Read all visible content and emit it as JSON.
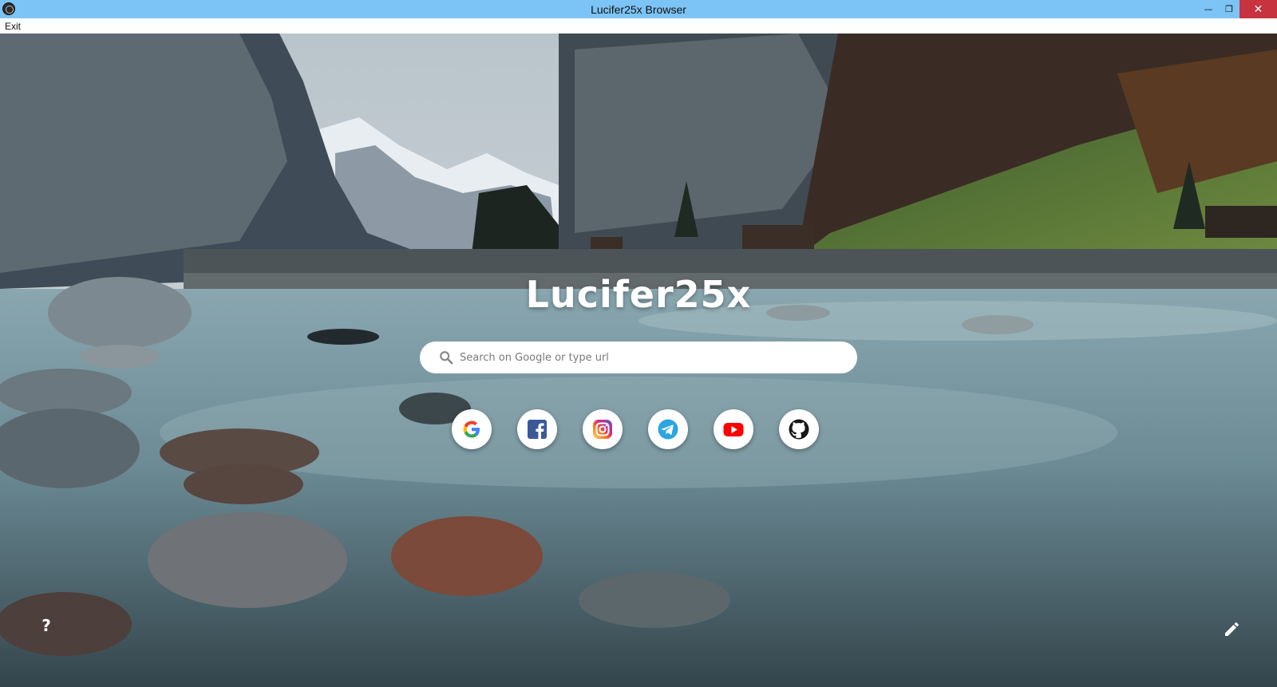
{
  "window": {
    "title": "Lucifer25x Browser",
    "minimize_glyph": "—",
    "restore_glyph": "❐",
    "close_glyph": "✕"
  },
  "menu": {
    "exit_label": "Exit"
  },
  "page": {
    "brand": "Lucifer25x",
    "search": {
      "placeholder": "Search on Google or type url",
      "value": ""
    },
    "shortcuts": [
      {
        "name": "google",
        "icon": "google-icon"
      },
      {
        "name": "facebook",
        "icon": "facebook-icon"
      },
      {
        "name": "instagram",
        "icon": "instagram-icon"
      },
      {
        "name": "telegram",
        "icon": "telegram-icon"
      },
      {
        "name": "youtube",
        "icon": "youtube-icon"
      },
      {
        "name": "github",
        "icon": "github-icon"
      }
    ],
    "help_label": "?",
    "edit_icon": "pencil-icon"
  },
  "colors": {
    "titlebar": "#7cc4f5",
    "close_button": "#c7333f",
    "facebook": "#3b5998",
    "telegram": "#2ca5e0",
    "youtube": "#ff0000",
    "github": "#181717"
  }
}
